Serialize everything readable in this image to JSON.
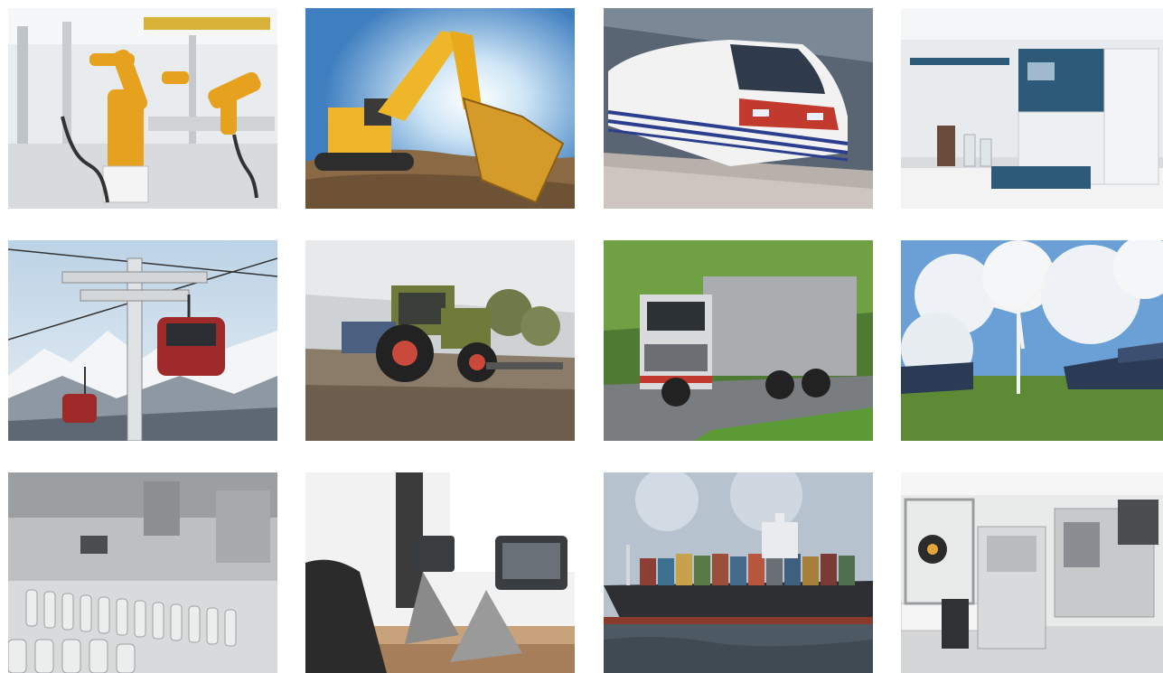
{
  "gallery": {
    "tiles": [
      {
        "icon": "industrial-robot-arm-icon"
      },
      {
        "icon": "excavator-icon"
      },
      {
        "icon": "high-speed-train-icon"
      },
      {
        "icon": "laboratory-analyzer-icon"
      },
      {
        "icon": "cable-car-gondola-icon"
      },
      {
        "icon": "tractor-icon"
      },
      {
        "icon": "garbage-truck-icon"
      },
      {
        "icon": "wind-turbine-solar-icon"
      },
      {
        "icon": "bottling-line-icon"
      },
      {
        "icon": "fitness-equipment-icon"
      },
      {
        "icon": "container-ship-icon"
      },
      {
        "icon": "cleanroom-machinery-icon"
      }
    ]
  },
  "colors": {
    "robot_orange": "#e6a11f",
    "excavator_yellow": "#f0b62a",
    "train_red": "#c23a2d",
    "lab_blue": "#2e5a7a",
    "gondola_red": "#9e2a2a",
    "tractor_green": "#6f7a3a",
    "truck_grey": "#a9adb0",
    "sky_blue": "#6aa0d6",
    "grass_green": "#5f8a35"
  }
}
